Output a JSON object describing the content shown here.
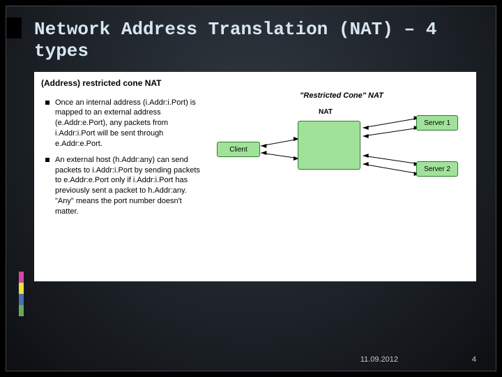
{
  "title": "Network Address Translation (NAT) – 4 types",
  "section": {
    "heading": "(Address) restricted cone NAT",
    "bullets": [
      "Once an internal address (i.Addr:i.Port) is mapped to an external address (e.Addr:e.Port), any packets from i.Addr:i.Port will be sent through e.Addr:e.Port.",
      "An external host (h.Addr:any) can send packets to i.Addr:i.Port by sending packets to e.Addr:e.Port only if i.Addr:i.Port has previously sent a packet to h.Addr:any. \"Any\" means the port number doesn't matter."
    ]
  },
  "diagram": {
    "caption": "\"Restricted Cone\" NAT",
    "nodes": {
      "client": "Client",
      "nat": "NAT",
      "server1": "Server 1",
      "server2": "Server 2"
    }
  },
  "strip_colors": [
    "#d24a9e",
    "#e8e337",
    "#4e6fae",
    "#6aa856"
  ],
  "footer": {
    "date": "11.09.2012",
    "page": "4"
  }
}
